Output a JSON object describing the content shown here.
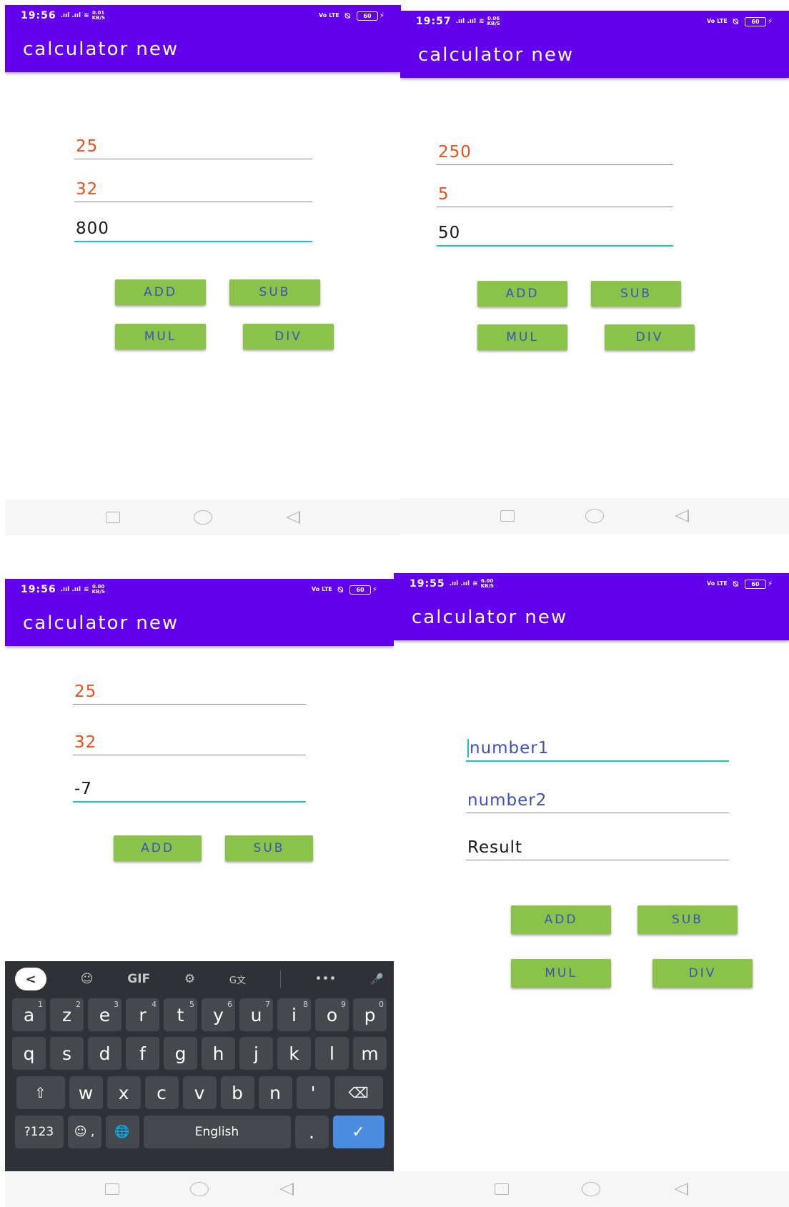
{
  "app_title": "calculator new",
  "status_icons": {
    "signal": ".ııl .ııl",
    "wifi": "≋",
    "volte": "Vo LTE",
    "mute": "⍉",
    "battery": "60",
    "charging": "⚡"
  },
  "buttons": {
    "add": "ADD",
    "sub": "SUB",
    "mul": "MUL",
    "div": "DIV"
  },
  "screens": [
    {
      "time": "19:56",
      "speed_top": "0.01",
      "speed_bottom": "KB/S",
      "input1": "25",
      "input2": "32",
      "result": "800"
    },
    {
      "time": "19:57",
      "speed_top": "0.06",
      "speed_bottom": "KB/S",
      "input1": "250",
      "input2": "5",
      "result": "50"
    },
    {
      "time": "19:56",
      "speed_top": "0.00",
      "speed_bottom": "KB/S",
      "input1": "25",
      "input2": "32",
      "result": "-7"
    },
    {
      "time": "19:55",
      "speed_top": "6.00",
      "speed_bottom": "KB/S",
      "input1_hint": "number1",
      "input2_hint": "number2",
      "result_hint": "Result"
    }
  ],
  "keyboard": {
    "toolbar": {
      "back": "<",
      "sticker": "☺",
      "gif": "GIF",
      "settings": "⚙",
      "translate": "G文",
      "more": "•••",
      "mic": "🎤"
    },
    "row1": [
      {
        "k": "a",
        "n": "1"
      },
      {
        "k": "z",
        "n": "2"
      },
      {
        "k": "e",
        "n": "3"
      },
      {
        "k": "r",
        "n": "4"
      },
      {
        "k": "t",
        "n": "5"
      },
      {
        "k": "y",
        "n": "6"
      },
      {
        "k": "u",
        "n": "7"
      },
      {
        "k": "i",
        "n": "8"
      },
      {
        "k": "o",
        "n": "9"
      },
      {
        "k": "p",
        "n": "0"
      }
    ],
    "row2": [
      "q",
      "s",
      "d",
      "f",
      "g",
      "h",
      "j",
      "k",
      "l",
      "m"
    ],
    "row3": [
      "w",
      "x",
      "c",
      "v",
      "b",
      "n",
      "'"
    ],
    "shift": "⇧",
    "backspace": "⌫",
    "symbols": "?123",
    "emoji_comma": "☺ ,",
    "globe": "🌐",
    "space": "English",
    "period": ".",
    "enter": "✓"
  }
}
